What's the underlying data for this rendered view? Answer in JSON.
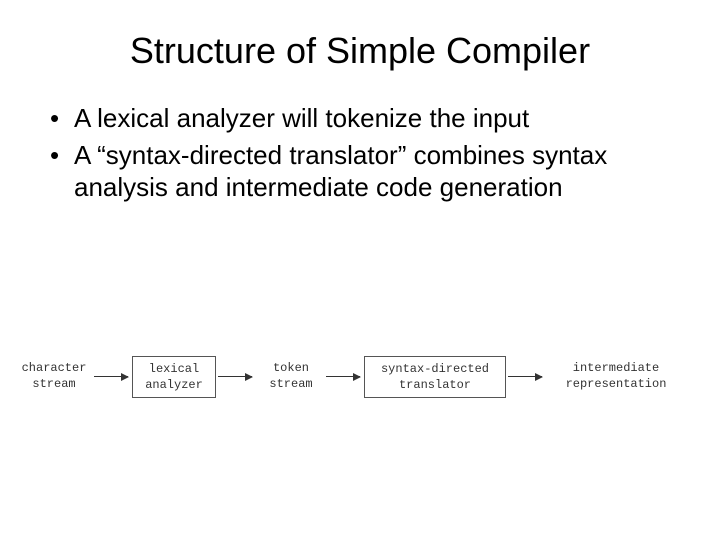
{
  "title": "Structure of Simple Compiler",
  "bullets": [
    "A lexical analyzer will tokenize the input",
    "A “syntax-directed translator” combines syntax analysis and intermediate code generation"
  ],
  "diagram": {
    "label_char_stream": "character\nstream",
    "box_lexical": "lexical\nanalyzer",
    "label_token_stream": "token\nstream",
    "box_translator": "syntax-directed\ntranslator",
    "label_intermediate": "intermediate\nrepresentation"
  }
}
